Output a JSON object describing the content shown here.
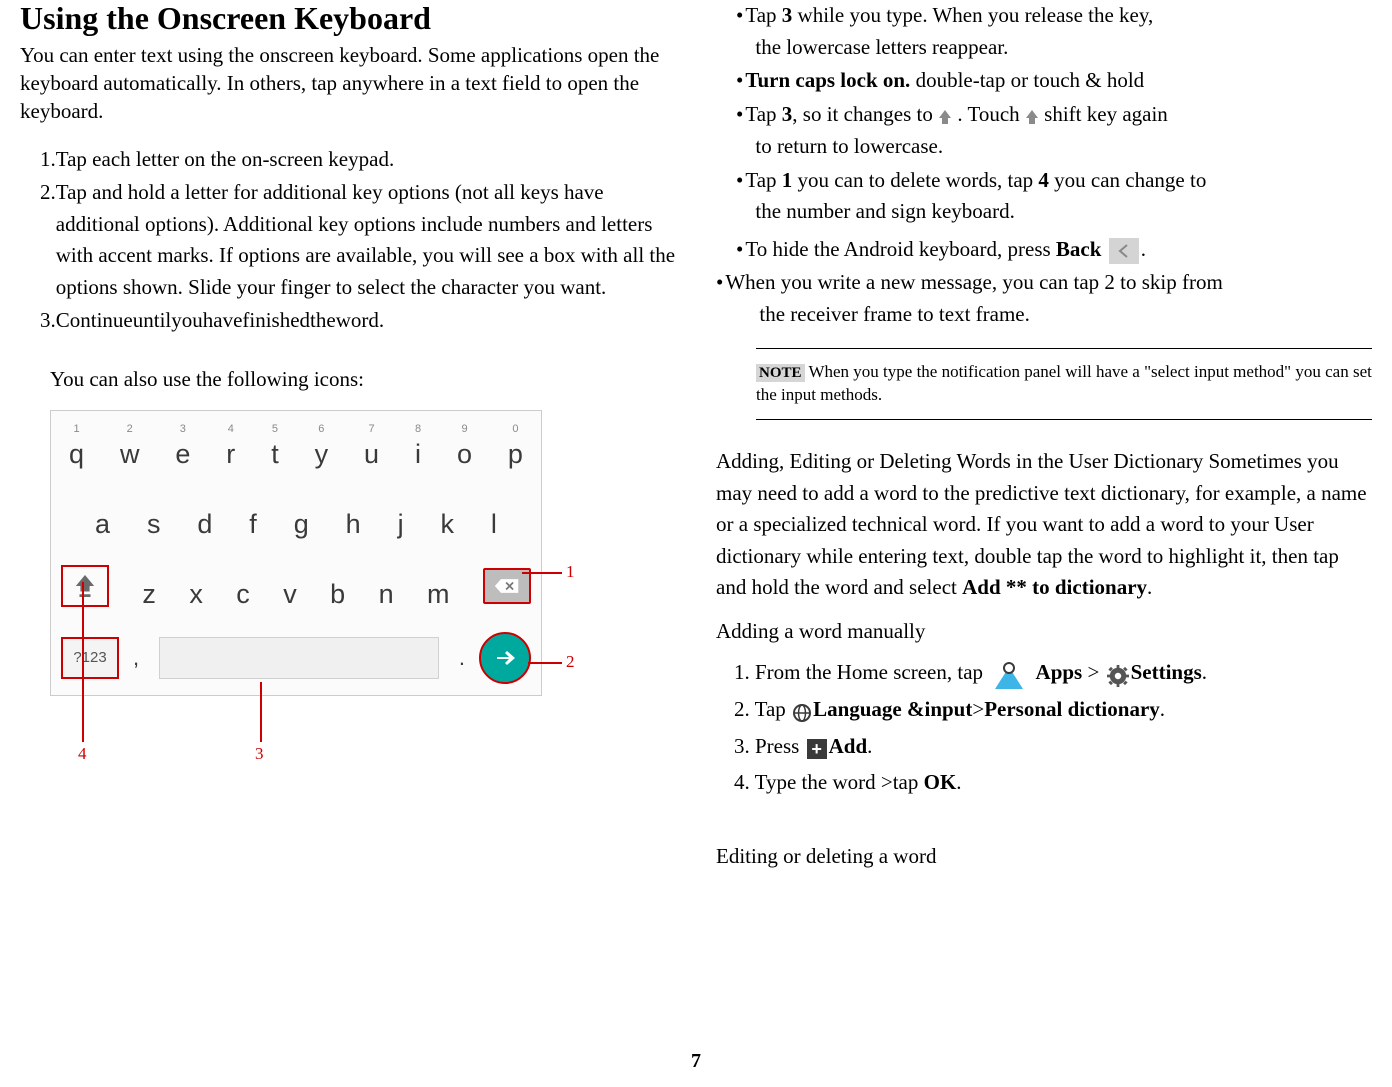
{
  "title": "Using the Onscreen Keyboard",
  "intro": "You can enter text using the onscreen keyboard. Some applications open the keyboard automatically. In others, tap anywhere in a text field to open the keyboard.",
  "left_list": {
    "n1": "1.",
    "t1": "Tap each letter on the on-screen keypad.",
    "n2": "2.",
    "t2": "Tap and hold a letter for additional key options (not all keys have additional options). Additional key options include numbers and letters with accent marks. If options are available, you will see a box with all the options shown. Slide your finger to select the character you want.",
    "n3": "3.",
    "t3": "Continueuntilyouhavefinishedtheword."
  },
  "sub_icons": "You can also use the following icons:",
  "kb": {
    "sup": [
      "1",
      "2",
      "3",
      "4",
      "5",
      "6",
      "7",
      "8",
      "9",
      "0"
    ],
    "row1": [
      "q",
      "w",
      "e",
      "r",
      "t",
      "y",
      "u",
      "i",
      "o",
      "p"
    ],
    "row2": [
      "a",
      "s",
      "d",
      "f",
      "g",
      "h",
      "j",
      "k",
      "l"
    ],
    "row3": [
      "z",
      "x",
      "c",
      "v",
      "b",
      "n",
      "m"
    ],
    "k123": "?123",
    "comma": ",",
    "dot": "."
  },
  "callouts": {
    "c1": "1",
    "c2": "2",
    "c3": "3",
    "c4": "4"
  },
  "bullets": {
    "b1a": "Tap ",
    "b1b": "3",
    "b1c": " while you type. When you release the key,",
    "b1d": "the lowercase letters reappear.",
    "b2a": "Turn caps lock on.",
    "b2b": " double-tap or touch & hold",
    "b3a": "Tap ",
    "b3b": "3",
    "b3c": ", so it changes to ",
    "b3d": " . Touch ",
    "b3e": "  shift key again",
    "b3f": "to return to lowercase.",
    "b4a": " Tap ",
    "b4b": "1",
    "b4c": " you can to delete words, tap ",
    "b4d": "4",
    "b4e": " you can change to",
    "b4f": "the number and sign keyboard.",
    "b5a": "To hide the Android keyboard, press ",
    "b5b": "Back",
    "b5c": "  ",
    "b5d": ".",
    "b6a": " When you write a new message, you can tap 2 to skip from",
    "b6b": "the receiver frame to text frame."
  },
  "note": {
    "label": "NOTE",
    "text": " When you type the notification panel will have a \"select input method\" you can set the input methods."
  },
  "dict": {
    "p1a": "Adding, Editing or Deleting Words in the User Dictionary Sometimes you may need to add a word to the predictive text dictionary, for example, a name or a specialized technical word. If you want to add a word to your User dictionary while entering text, double tap the word to highlight it, then tap and hold the word and select ",
    "p1b": "Add ** to dictionary",
    "p1c": ".",
    "h2": "Adding a word manually",
    "s1a": "1. From the Home screen, tap ",
    "s1b": "Apps",
    "s1c": " > ",
    "s1d": "Settings",
    "s1e": ".",
    "s2a": "2. Tap ",
    "s2b": "Language &input",
    "s2c": ">",
    "s2d": "Personal dictionary",
    "s2e": ".",
    "s3a": "3. Press ",
    "s3b": "Add",
    "s3c": ".",
    "s4a": "4. Type the word >tap ",
    "s4b": "OK",
    "s4c": ".",
    "h3": "Editing or deleting a word"
  },
  "page": "7"
}
